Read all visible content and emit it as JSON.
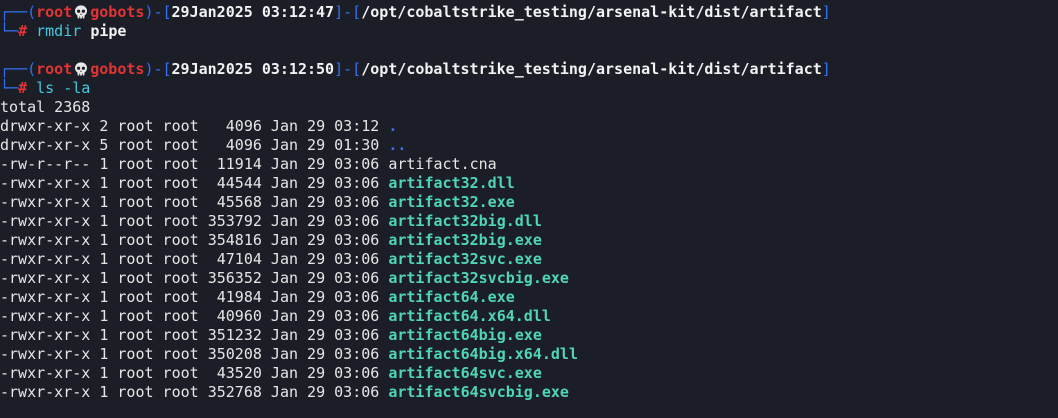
{
  "colors": {
    "background": "#1b1e27",
    "prompt_frame": "#3470f0",
    "prompt_user": "#e13434",
    "command": "#46c8e0",
    "executable": "#4fd6b4",
    "directory": "#3b6fe8",
    "text": "#e6e6e6"
  },
  "prompts": [
    {
      "user": "root",
      "host": "gobots",
      "time": "29Jan2025 03:12:47",
      "path": "/opt/cobaltstrike_testing/arsenal-kit/dist/artifact",
      "symbol": "#",
      "command": "rmdir",
      "args": "pipe"
    },
    {
      "user": "root",
      "host": "gobots",
      "time": "29Jan2025 03:12:50",
      "path": "/opt/cobaltstrike_testing/arsenal-kit/dist/artifact",
      "symbol": "#",
      "command": "ls",
      "args": "-la"
    }
  ],
  "listing": {
    "total": "total 2368",
    "rows": [
      {
        "meta": "drwxr-xr-x 2 root root   4096 Jan 29 03:12 ",
        "name": "."
      },
      {
        "meta": "drwxr-xr-x 5 root root   4096 Jan 29 01:30 ",
        "name": ".."
      },
      {
        "meta": "-rw-r--r-- 1 root root  11914 Jan 29 03:06 ",
        "name": "artifact.cna"
      },
      {
        "meta": "-rwxr-xr-x 1 root root  44544 Jan 29 03:06 ",
        "name": "artifact32.dll"
      },
      {
        "meta": "-rwxr-xr-x 1 root root  45568 Jan 29 03:06 ",
        "name": "artifact32.exe"
      },
      {
        "meta": "-rwxr-xr-x 1 root root 353792 Jan 29 03:06 ",
        "name": "artifact32big.dll"
      },
      {
        "meta": "-rwxr-xr-x 1 root root 354816 Jan 29 03:06 ",
        "name": "artifact32big.exe"
      },
      {
        "meta": "-rwxr-xr-x 1 root root  47104 Jan 29 03:06 ",
        "name": "artifact32svc.exe"
      },
      {
        "meta": "-rwxr-xr-x 1 root root 356352 Jan 29 03:06 ",
        "name": "artifact32svcbig.exe"
      },
      {
        "meta": "-rwxr-xr-x 1 root root  41984 Jan 29 03:06 ",
        "name": "artifact64.exe"
      },
      {
        "meta": "-rwxr-xr-x 1 root root  40960 Jan 29 03:06 ",
        "name": "artifact64.x64.dll"
      },
      {
        "meta": "-rwxr-xr-x 1 root root 351232 Jan 29 03:06 ",
        "name": "artifact64big.exe"
      },
      {
        "meta": "-rwxr-xr-x 1 root root 350208 Jan 29 03:06 ",
        "name": "artifact64big.x64.dll"
      },
      {
        "meta": "-rwxr-xr-x 1 root root  43520 Jan 29 03:06 ",
        "name": "artifact64svc.exe"
      },
      {
        "meta": "-rwxr-xr-x 1 root root 352768 Jan 29 03:06 ",
        "name": "artifact64svcbig.exe"
      }
    ]
  }
}
